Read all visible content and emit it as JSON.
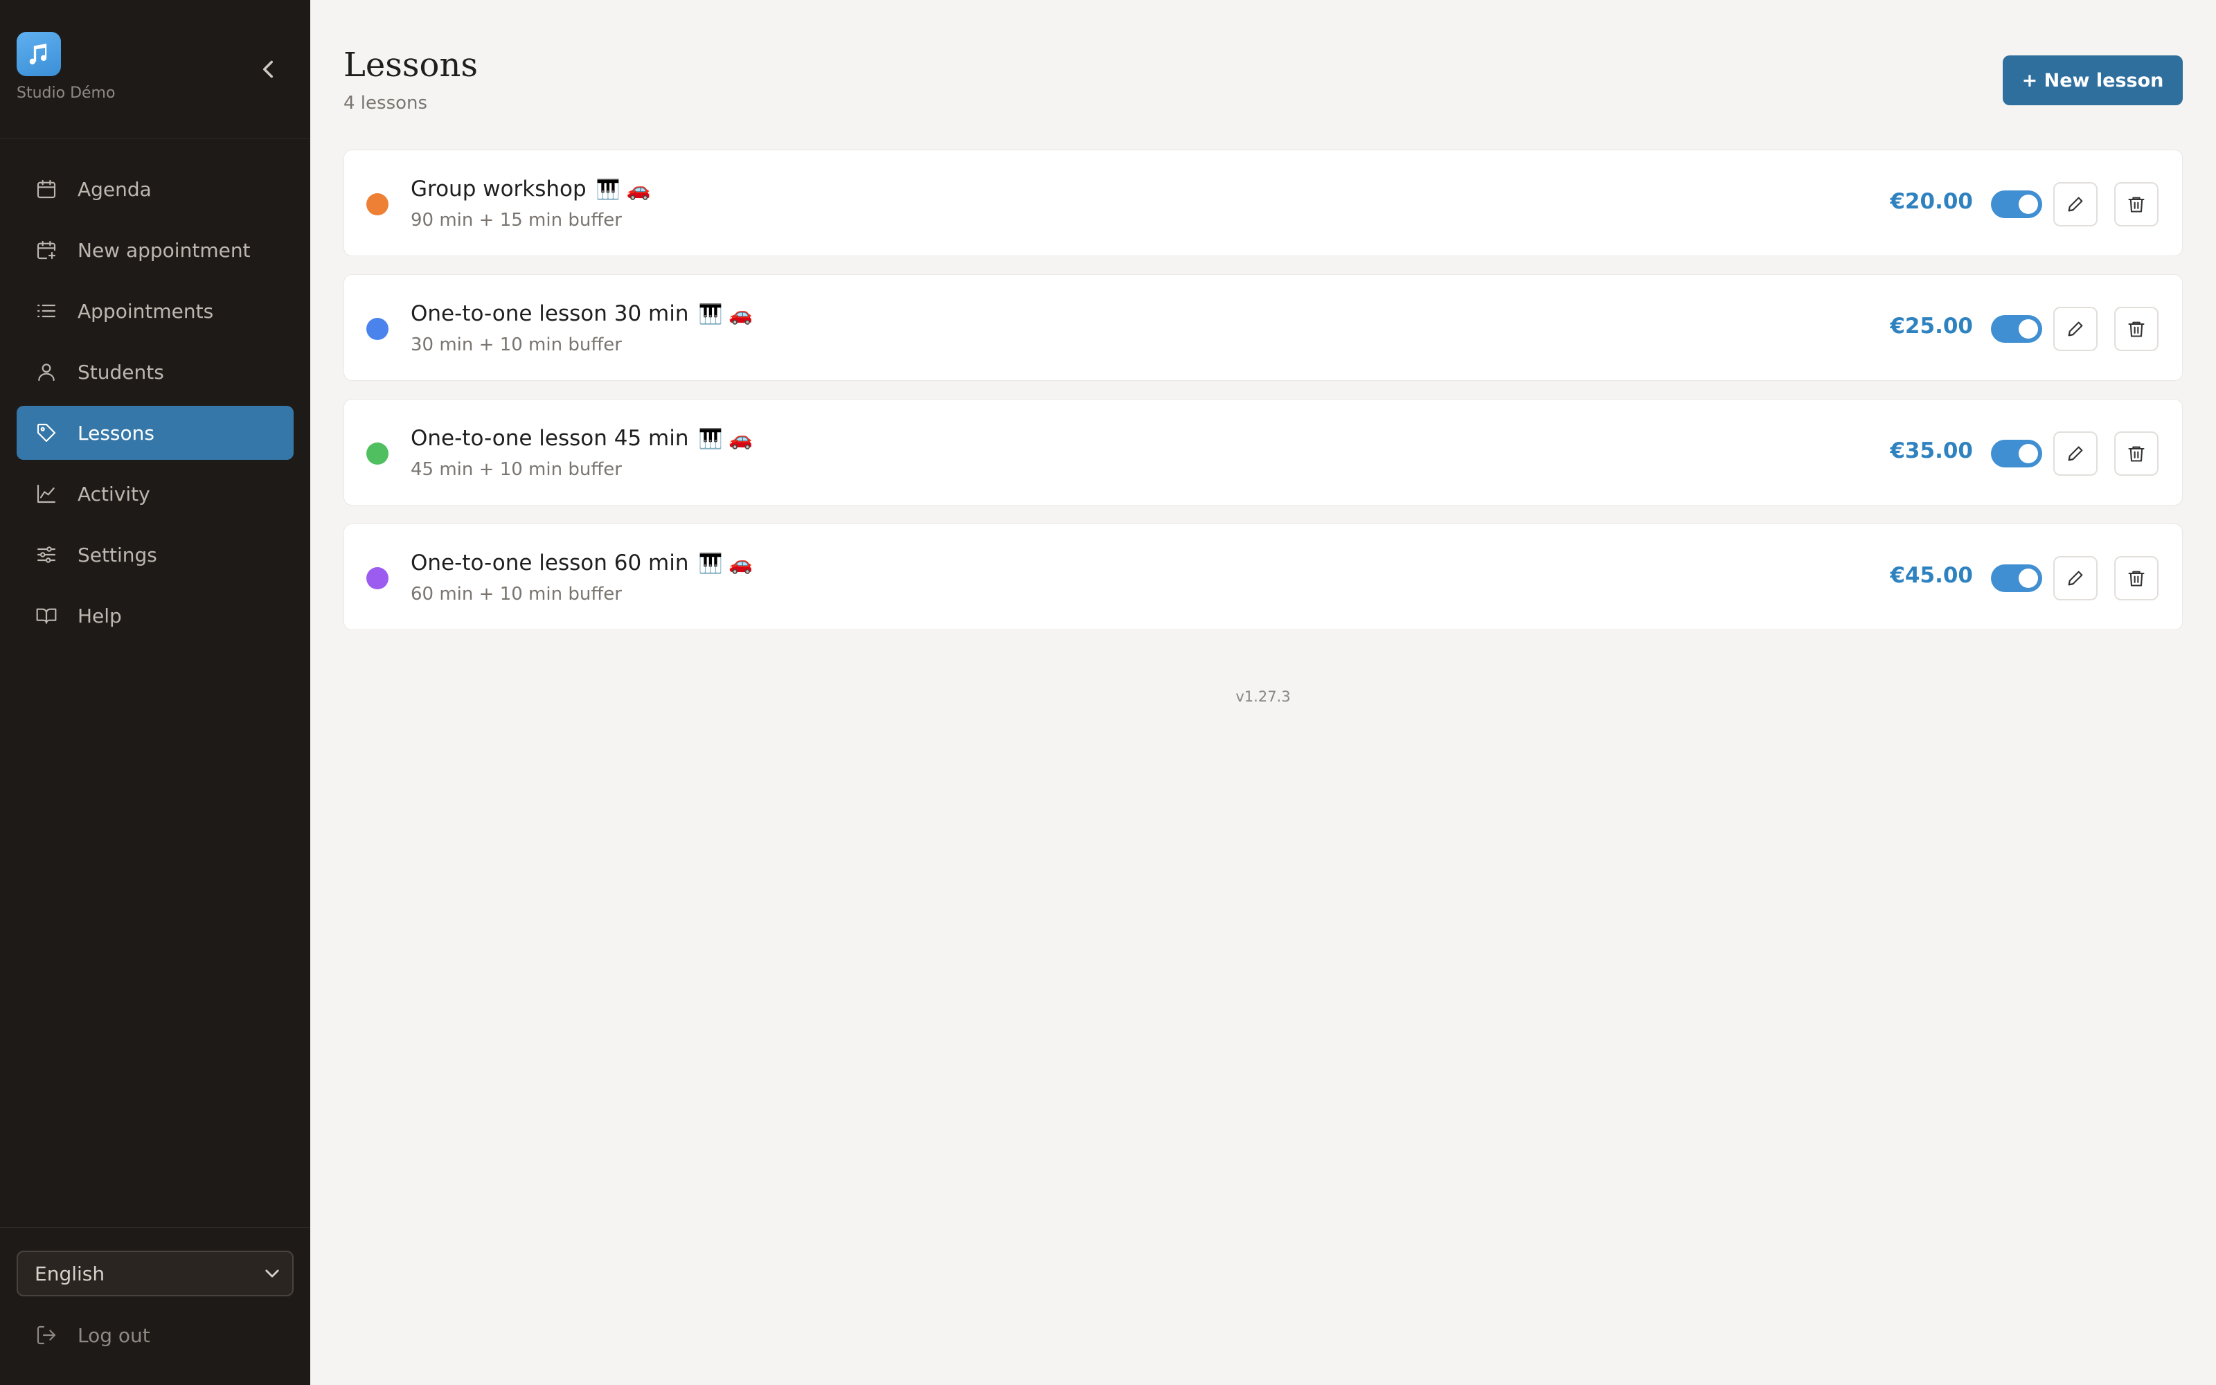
{
  "sidebar": {
    "brand_name": "Studio Démo",
    "nav": [
      {
        "label": "Agenda",
        "icon": "calendar-icon"
      },
      {
        "label": "New appointment",
        "icon": "calendar-plus-icon"
      },
      {
        "label": "Appointments",
        "icon": "list-icon"
      },
      {
        "label": "Students",
        "icon": "user-icon"
      },
      {
        "label": "Lessons",
        "icon": "tag-icon",
        "active": true
      },
      {
        "label": "Activity",
        "icon": "chart-line-icon"
      },
      {
        "label": "Settings",
        "icon": "sliders-icon"
      },
      {
        "label": "Help",
        "icon": "book-icon"
      }
    ],
    "language": "English",
    "logout_label": "Log out"
  },
  "header": {
    "title": "Lessons",
    "subtitle": "4 lessons",
    "new_button": "+ New lesson"
  },
  "lessons": [
    {
      "name": "Group workshop",
      "meta": "90 min + 15 min buffer",
      "price": "€20.00",
      "color": "#ee8036",
      "emoji": "🎹 🚗",
      "enabled": true
    },
    {
      "name": "One-to-one lesson 30 min",
      "meta": "30 min + 10 min buffer",
      "price": "€25.00",
      "color": "#4b83ec",
      "emoji": "🎹 🚗",
      "enabled": true
    },
    {
      "name": "One-to-one lesson 45 min",
      "meta": "45 min + 10 min buffer",
      "price": "€35.00",
      "color": "#4fbf5f",
      "emoji": "🎹 🚗",
      "enabled": true
    },
    {
      "name": "One-to-one lesson 60 min",
      "meta": "60 min + 10 min buffer",
      "price": "€45.00",
      "color": "#9d5cf0",
      "emoji": "🎹 🚗",
      "enabled": true
    }
  ],
  "footer": {
    "version": "v1.27.3"
  },
  "colors": {
    "sidebar_bg": "#1e1a17",
    "accent": "#3577a8",
    "price": "#2f82c0",
    "toggle_on": "#3f8fd2"
  }
}
